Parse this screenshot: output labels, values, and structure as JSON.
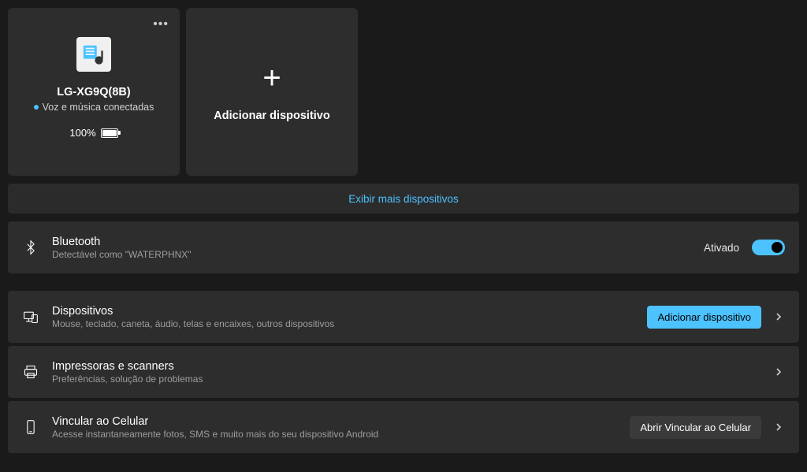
{
  "device_card": {
    "name": "LG-XG9Q(8B)",
    "status": "Voz e música conectadas",
    "battery": "100%"
  },
  "add_card": {
    "label": "Adicionar dispositivo"
  },
  "show_more": "Exibir mais dispositivos",
  "bluetooth": {
    "title": "Bluetooth",
    "subtitle": "Detectável como \"WATERPHNX\"",
    "state_label": "Ativado"
  },
  "devices": {
    "title": "Dispositivos",
    "subtitle": "Mouse, teclado, caneta, áudio, telas e encaixes, outros dispositivos",
    "button": "Adicionar dispositivo"
  },
  "printers": {
    "title": "Impressoras e scanners",
    "subtitle": "Preferências, solução de problemas"
  },
  "phone_link": {
    "title": "Vincular ao Celular",
    "subtitle": "Acesse instantaneamente fotos, SMS e muito mais do seu dispositivo Android",
    "button": "Abrir Vincular ao Celular"
  }
}
